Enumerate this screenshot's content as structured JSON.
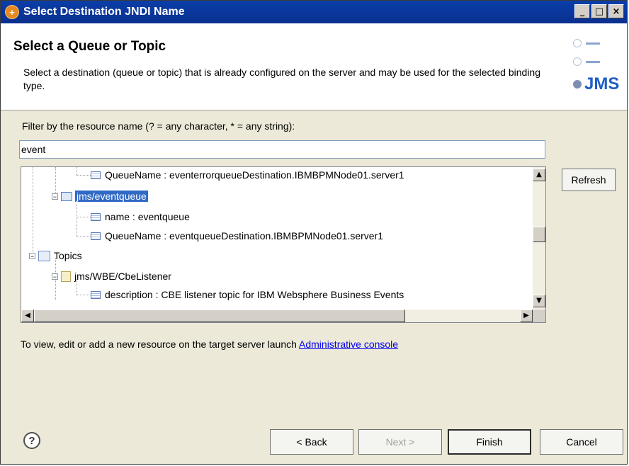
{
  "window": {
    "title": "Select Destination JNDI Name",
    "minimize": "_",
    "maximize": "□",
    "close": "×"
  },
  "header": {
    "title": "Select a Queue or Topic",
    "description": "Select a destination (queue or topic) that is already configured on the server and may be used for the selected binding type.",
    "logo_text": "JMS"
  },
  "filter": {
    "label": "Filter by the resource name (? = any character, * = any string):",
    "value": "event"
  },
  "tree": {
    "items": [
      {
        "label": "QueueName : eventerrorqueueDestination.IBMBPMNode01.server1"
      },
      {
        "label": "jms/eventqueue"
      },
      {
        "label": "name : eventqueue"
      },
      {
        "label": "QueueName : eventqueueDestination.IBMBPMNode01.server1"
      },
      {
        "label": "Topics"
      },
      {
        "label": "jms/WBE/CbeListener"
      },
      {
        "label": "description : CBE listener topic for IBM Websphere Business Events"
      }
    ]
  },
  "refresh_label": "Refresh",
  "info": {
    "text": "To view, edit or add a new resource on the target server launch ",
    "link": "Administrative console"
  },
  "buttons": {
    "back": "< Back",
    "next": "Next >",
    "finish": "Finish",
    "cancel": "Cancel"
  },
  "help_symbol": "?",
  "colors": {
    "titlebar": "#0a3ea8",
    "selection": "#316ac5",
    "jms": "#1f5ec5",
    "link": "#0000ee"
  }
}
